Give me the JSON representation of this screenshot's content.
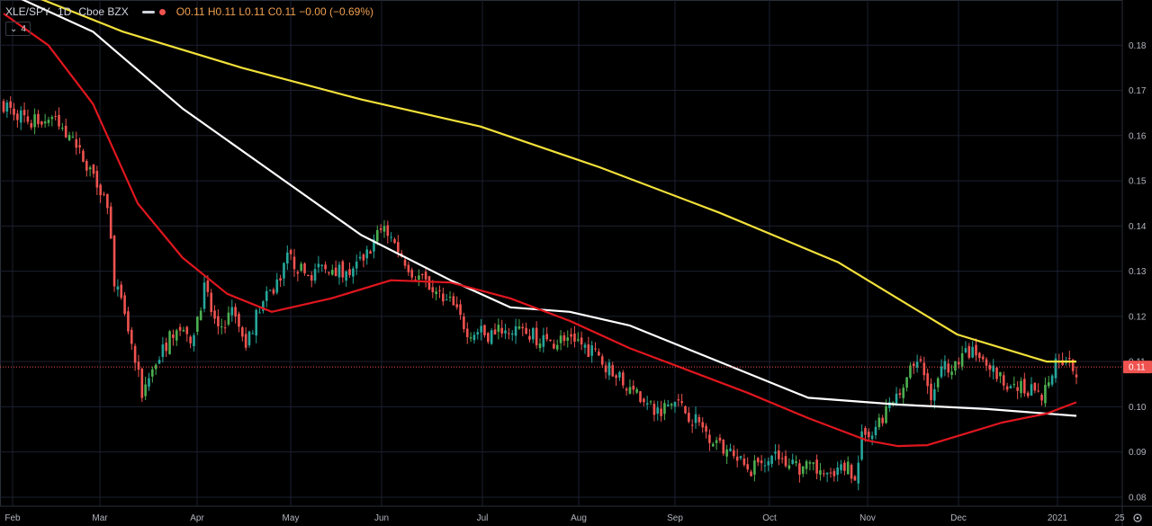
{
  "header": {
    "symbol": "XLE/SPY",
    "timeframe": "1D",
    "exchange": "Cboe BZX",
    "ohlc": "O0.11 H0.11 L0.11 C0.11 −0.00 (−0.69%)",
    "indicator_count": "4"
  },
  "colors": {
    "up": "#26a69a",
    "up_green": "#4caf50",
    "down": "#ef5350",
    "ma_yellow": "#f2e03a",
    "ma_white": "#ffffff",
    "ma_red": "#e0161e",
    "grid": "#1c2030",
    "axis_text": "#b2b5be"
  },
  "chart_data": {
    "type": "candlestick",
    "y_ticks": [
      "0.08",
      "0.09",
      "0.10",
      "0.11",
      "0.12",
      "0.13",
      "0.14",
      "0.15",
      "0.16",
      "0.17",
      "0.18"
    ],
    "ylim": [
      0.078,
      0.19
    ],
    "x_ticks": [
      "Feb",
      "Mar",
      "Apr",
      "May",
      "Jun",
      "Jul",
      "Aug",
      "Sep",
      "Oct",
      "Nov",
      "Dec",
      "2021",
      "25"
    ],
    "last_price_label": "0.11",
    "last_price": 0.1088,
    "moving_averages": [
      {
        "color": "#f2e03a",
        "points": [
          [
            0,
            0.1935
          ],
          [
            40,
            0.183
          ],
          [
            80,
            0.175
          ],
          [
            120,
            0.168
          ],
          [
            160,
            0.162
          ],
          [
            200,
            0.153
          ],
          [
            240,
            0.143
          ],
          [
            280,
            0.132
          ],
          [
            300,
            0.124
          ],
          [
            320,
            0.116
          ],
          [
            340,
            0.112
          ],
          [
            350,
            0.11
          ],
          [
            360,
            0.11
          ]
        ]
      },
      {
        "color": "#ffffff",
        "points": [
          [
            0,
            0.192
          ],
          [
            30,
            0.183
          ],
          [
            60,
            0.166
          ],
          [
            90,
            0.152
          ],
          [
            120,
            0.138
          ],
          [
            150,
            0.128
          ],
          [
            170,
            0.122
          ],
          [
            190,
            0.121
          ],
          [
            210,
            0.118
          ],
          [
            240,
            0.11
          ],
          [
            270,
            0.102
          ],
          [
            300,
            0.1005
          ],
          [
            330,
            0.0995
          ],
          [
            360,
            0.098
          ]
        ]
      },
      {
        "color": "#e0161e",
        "points": [
          [
            0,
            0.187
          ],
          [
            15,
            0.18
          ],
          [
            30,
            0.167
          ],
          [
            45,
            0.145
          ],
          [
            60,
            0.133
          ],
          [
            75,
            0.125
          ],
          [
            90,
            0.121
          ],
          [
            110,
            0.124
          ],
          [
            130,
            0.128
          ],
          [
            150,
            0.1275
          ],
          [
            170,
            0.124
          ],
          [
            190,
            0.119
          ],
          [
            210,
            0.113
          ],
          [
            230,
            0.108
          ],
          [
            250,
            0.103
          ],
          [
            270,
            0.0975
          ],
          [
            290,
            0.0925
          ],
          [
            300,
            0.0913
          ],
          [
            310,
            0.0915
          ],
          [
            320,
            0.0935
          ],
          [
            335,
            0.0965
          ],
          [
            350,
            0.0985
          ],
          [
            360,
            0.101
          ]
        ]
      }
    ]
  }
}
